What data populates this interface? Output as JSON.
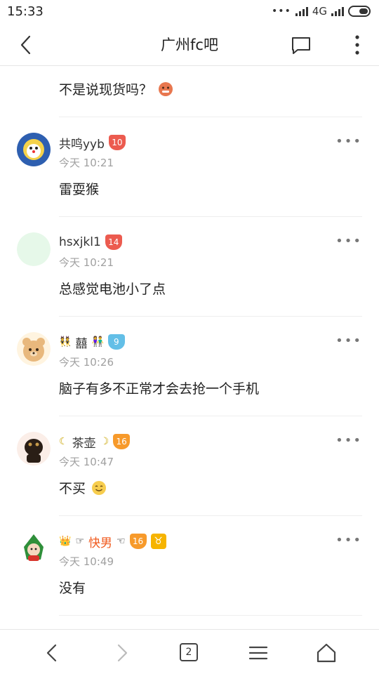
{
  "status": {
    "time": "15:33",
    "network": "4G"
  },
  "header": {
    "title": "广州fc吧"
  },
  "top_post": {
    "text": "不是说现货吗？"
  },
  "comments": [
    {
      "name": "共鸣yyb",
      "level": "10",
      "time": "今天 10:21",
      "text": "雷耍猴"
    },
    {
      "name": "hsxjkl1",
      "level": "14",
      "time": "今天 10:21",
      "text": "总感觉电池小了点"
    },
    {
      "name": "囍",
      "level": "9",
      "time": "今天 10:26",
      "text": "脑子有多不正常才会去抢一个手机"
    },
    {
      "name": "茶壶",
      "level": "16",
      "time": "今天 10:47",
      "text": "不买"
    },
    {
      "name": "快男",
      "level": "16",
      "time": "今天 10:49",
      "text": "没有"
    }
  ],
  "bottom_nav": {
    "tab_count": "2"
  },
  "colors": {
    "accent_orange": "#f05a1e",
    "badge_red": "#ec5b4f",
    "badge_blue": "#63bfe7",
    "badge_orange": "#f79a2b",
    "taurus": "#f6b400"
  },
  "icons": [
    "back-icon",
    "chat-icon",
    "more-vertical-icon",
    "options-icon",
    "nav-back-icon",
    "nav-forward-icon",
    "tabs-icon",
    "menu-icon",
    "home-icon"
  ]
}
